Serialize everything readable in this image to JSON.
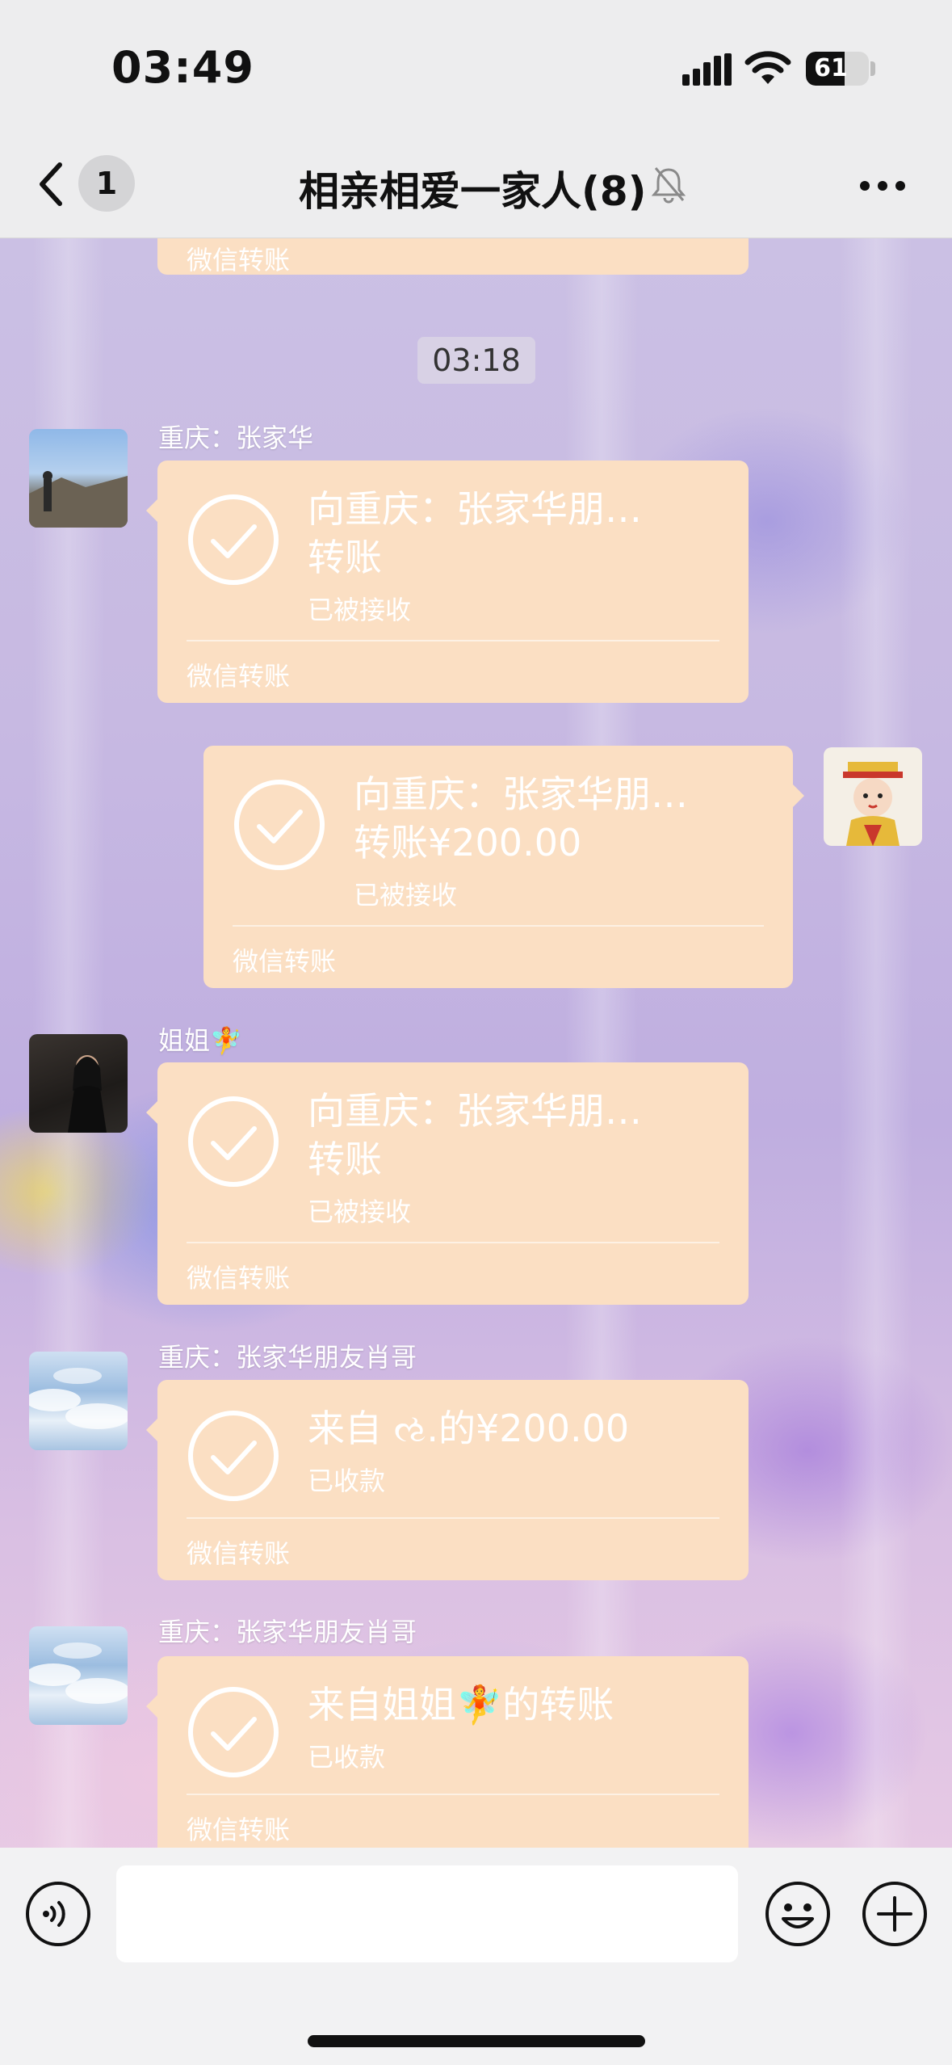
{
  "status_bar": {
    "time": "03:49",
    "battery": "61",
    "battery_level": 0.61
  },
  "nav": {
    "unread_count": "1",
    "title": "相亲相爱一家人(8)"
  },
  "chat": {
    "top_partial_footer": "微信转账",
    "timestamp": "03:18",
    "messages": [
      {
        "sender": "重庆：张家华",
        "title_line1": "向重庆：张家华朋…",
        "title_line2": "转账",
        "status": "已被接收",
        "footer": "微信转账",
        "side": "left",
        "avatar": "mountain-photo-avatar"
      },
      {
        "sender": "",
        "title_line1": "向重庆：张家华朋…",
        "title_line2": "转账¥200.00",
        "status": "已被接收",
        "footer": "微信转账",
        "side": "right",
        "avatar": "cartoon-emperor-avatar"
      },
      {
        "sender": "姐姐🧚",
        "title_line1": "向重庆：张家华朋…",
        "title_line2": "转账",
        "status": "已被接收",
        "footer": "微信转账",
        "side": "left",
        "avatar": "woman-photo-avatar"
      },
      {
        "sender": "重庆：张家华朋友肖哥",
        "title_line1": "来自 ઌ.的¥200.00",
        "status": "已收款",
        "footer": "微信转账",
        "side": "left",
        "avatar": "clouds-avatar"
      },
      {
        "sender": "重庆：张家华朋友肖哥",
        "title_line1": "来自姐姐🧚的转账",
        "status": "已收款",
        "footer": "微信转账",
        "side": "left",
        "avatar": "clouds-avatar"
      }
    ]
  },
  "input_bar": {
    "placeholder": ""
  },
  "colors": {
    "bubble": "#fbdfc3",
    "bar_bg": "#ededee"
  }
}
